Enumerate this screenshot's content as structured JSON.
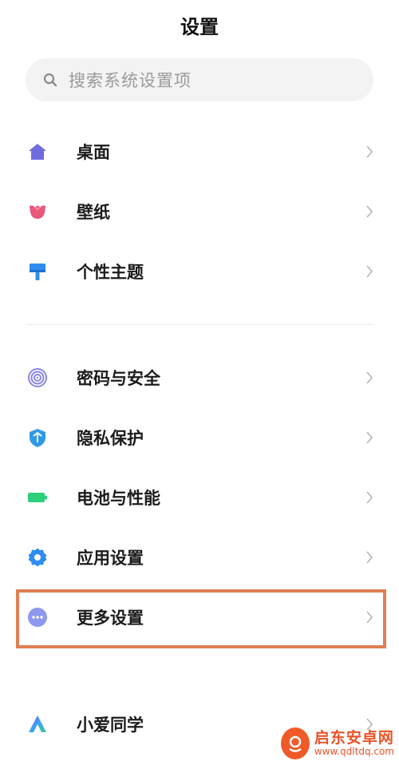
{
  "header": {
    "title": "设置"
  },
  "search": {
    "placeholder": "搜索系统设置项",
    "icon": "search-icon"
  },
  "groups": [
    {
      "items": [
        {
          "label": "桌面",
          "icon": "home-icon",
          "color": "#6e6ce0"
        },
        {
          "label": "壁纸",
          "icon": "tulip-icon",
          "color": "#e9577a"
        },
        {
          "label": "个性主题",
          "icon": "paintbrush-icon",
          "color": "#2f8cf0"
        }
      ]
    },
    {
      "items": [
        {
          "label": "密码与安全",
          "icon": "fingerprint-icon",
          "color": "#8b84e6"
        },
        {
          "label": "隐私保护",
          "icon": "shield-icon",
          "color": "#2f9ae8"
        },
        {
          "label": "电池与性能",
          "icon": "battery-icon",
          "color": "#2ecf7a"
        },
        {
          "label": "应用设置",
          "icon": "gear-icon",
          "color": "#2f8cf0"
        },
        {
          "label": "更多设置",
          "icon": "more-icon",
          "color": "#8e98f0",
          "highlighted": true
        }
      ]
    },
    {
      "items": [
        {
          "label": "小爱同学",
          "icon": "xiaoai-icon",
          "color": "#4d7cf5"
        }
      ]
    }
  ],
  "highlight_color": "#e17f53",
  "watermark": {
    "name": "启东安卓网",
    "url": "www.qdltdq.com",
    "color": "#e8542a"
  }
}
